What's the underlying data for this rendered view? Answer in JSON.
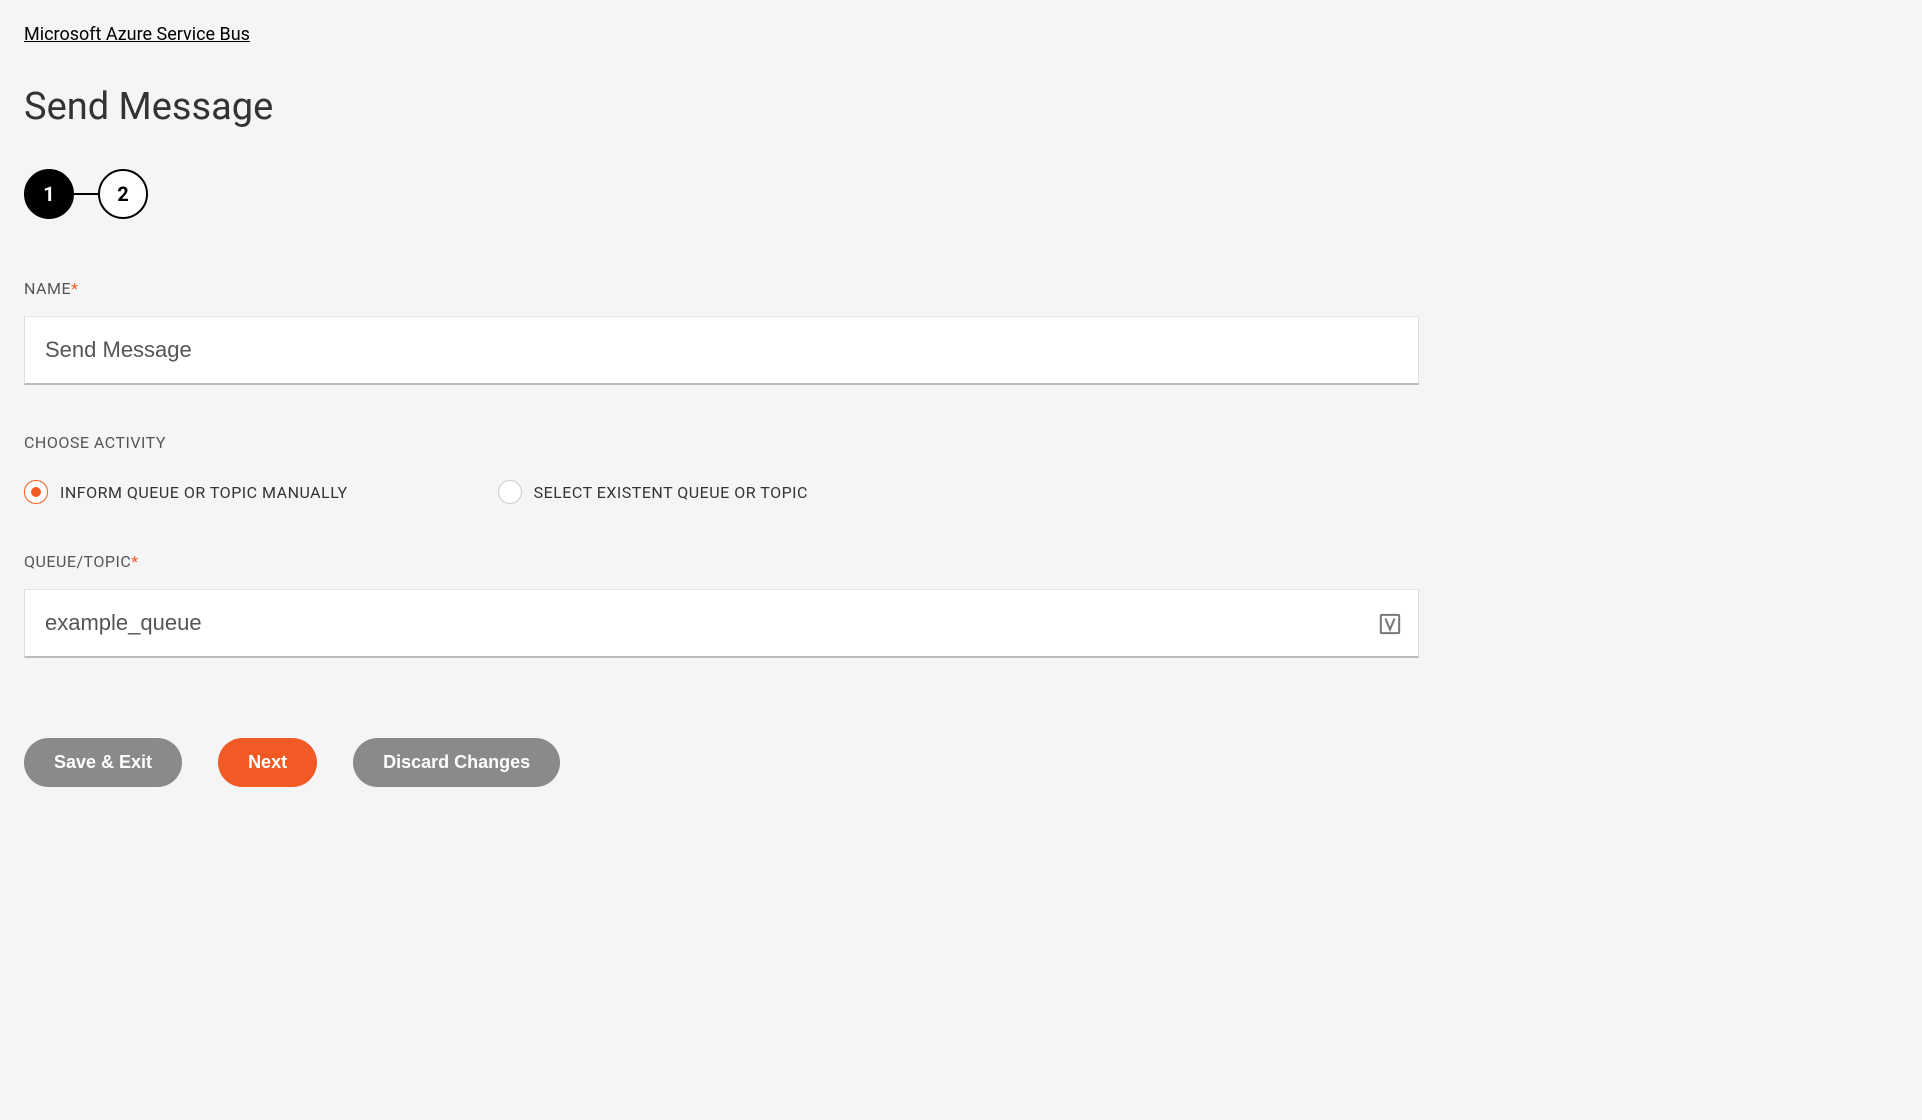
{
  "breadcrumb": {
    "label": "Microsoft Azure Service Bus"
  },
  "page": {
    "title": "Send Message"
  },
  "stepper": {
    "steps": [
      "1",
      "2"
    ],
    "active_index": 0
  },
  "form": {
    "name": {
      "label": "NAME",
      "required_mark": "*",
      "value": "Send Message"
    },
    "activity": {
      "label": "CHOOSE ACTIVITY",
      "options": [
        {
          "label": "INFORM QUEUE OR TOPIC MANUALLY",
          "selected": true
        },
        {
          "label": "SELECT EXISTENT QUEUE OR TOPIC",
          "selected": false
        }
      ]
    },
    "queue_topic": {
      "label": "QUEUE/TOPIC",
      "required_mark": "*",
      "value": "example_queue",
      "icon_glyph": "V"
    }
  },
  "buttons": {
    "save_exit": "Save & Exit",
    "next": "Next",
    "discard": "Discard Changes"
  }
}
